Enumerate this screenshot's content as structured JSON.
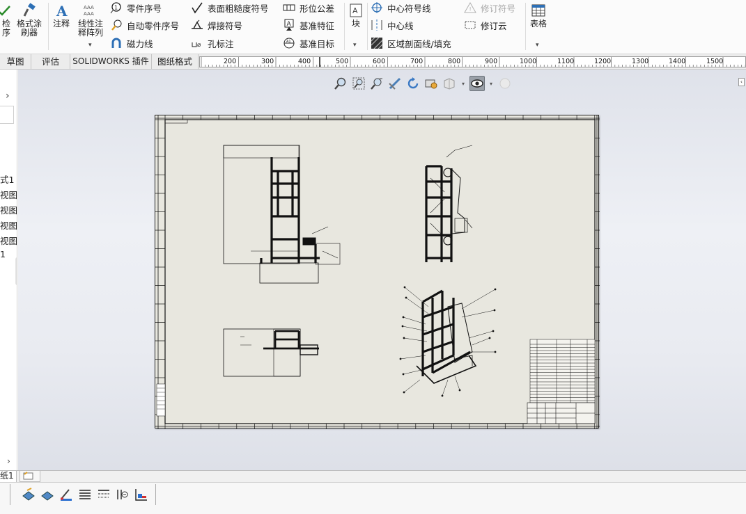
{
  "ribbon": {
    "check_label": "检\n序",
    "format_painter_label": "格式涂\n刷器",
    "note_label": "注释",
    "linear_note_label": "线性注\n释阵列",
    "balloon_label": "零件序号",
    "auto_balloon_label": "自动零件序号",
    "magnetic_line_label": "磁力线",
    "surface_finish_label": "表面粗糙度符号",
    "weld_symbol_label": "焊接符号",
    "hole_callout_label": "孔标注",
    "gdt_label": "形位公差",
    "datum_feature_label": "基准特征",
    "datum_target_label": "基准目标",
    "block_label": "块",
    "centermark_label": "中心符号线",
    "centerline_label": "中心线",
    "hatch_label": "区域剖面线/填充",
    "revision_symbol_label": "修订符号",
    "revision_cloud_label": "修订云",
    "table_label": "表格"
  },
  "tabs": [
    {
      "label": "草图"
    },
    {
      "label": "评估"
    },
    {
      "label": "SOLIDWORKS 插件"
    },
    {
      "label": "图纸格式"
    }
  ],
  "ruler": {
    "labels": [
      "200",
      "300",
      "400",
      "500",
      "600",
      "700",
      "800",
      "900",
      "1000",
      "1100",
      "1200",
      "1300",
      "1400",
      "1500"
    ]
  },
  "left_panel": {
    "items": [
      "式1",
      "视图",
      "视图",
      "视图",
      "视图",
      "1"
    ]
  },
  "sheet_tabs": {
    "current": "纸1"
  }
}
